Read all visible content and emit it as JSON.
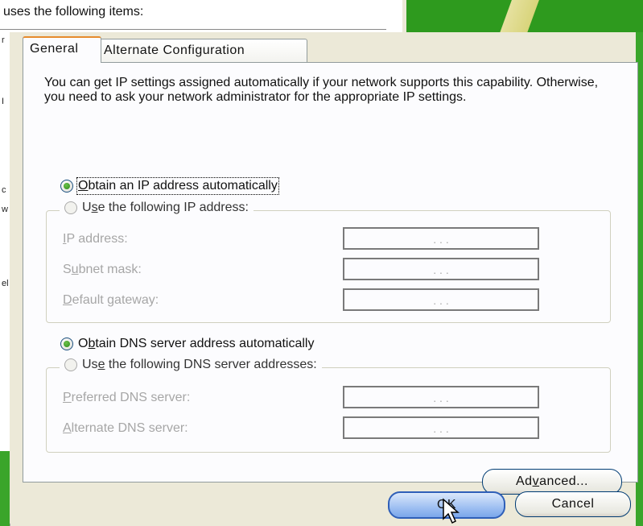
{
  "background": {
    "partial_text": "uses the following items:"
  },
  "tabs": [
    {
      "label": "General",
      "active": true
    },
    {
      "label": "Alternate Configuration",
      "active": false
    }
  ],
  "intro_text": "You can get IP settings assigned automatically if your network supports this capability. Otherwise, you need to ask your network administrator for the appropriate IP settings.",
  "ip_section": {
    "auto_option": {
      "prefix": "",
      "accel": "O",
      "suffix": "btain an IP address automatically",
      "checked": true
    },
    "manual_option": {
      "prefix": "U",
      "accel": "s",
      "suffix": "e the following IP address:",
      "checked": false
    },
    "fields": [
      {
        "prefix": "",
        "accel": "I",
        "suffix": "P address:",
        "value": ". . ."
      },
      {
        "prefix": "S",
        "accel": "u",
        "suffix": "bnet mask:",
        "value": ". . ."
      },
      {
        "prefix": "",
        "accel": "D",
        "suffix": "efault gateway:",
        "value": ". . ."
      }
    ]
  },
  "dns_section": {
    "auto_option": {
      "prefix": "O",
      "accel": "b",
      "suffix": "tain DNS server address automatically",
      "checked": true
    },
    "manual_option": {
      "prefix": "Us",
      "accel": "e",
      "suffix": " the following DNS server addresses:",
      "checked": false
    },
    "fields": [
      {
        "prefix": "",
        "accel": "P",
        "suffix": "referred DNS server:",
        "value": ". . ."
      },
      {
        "prefix": "",
        "accel": "A",
        "suffix": "lternate DNS server:",
        "value": ". . ."
      }
    ]
  },
  "buttons": {
    "advanced": {
      "prefix": "Ad",
      "accel": "v",
      "suffix": "anced..."
    },
    "ok": "OK",
    "cancel": "Cancel"
  },
  "colors": {
    "dialog_bg": "#ece9d8",
    "panel_bg": "#fcfcfe",
    "active_tab_highlight": "#e68b2c",
    "radio_checked": "#2d8a1a",
    "default_button": "#7aa6ea",
    "disabled_text": "#a6a6a6"
  }
}
